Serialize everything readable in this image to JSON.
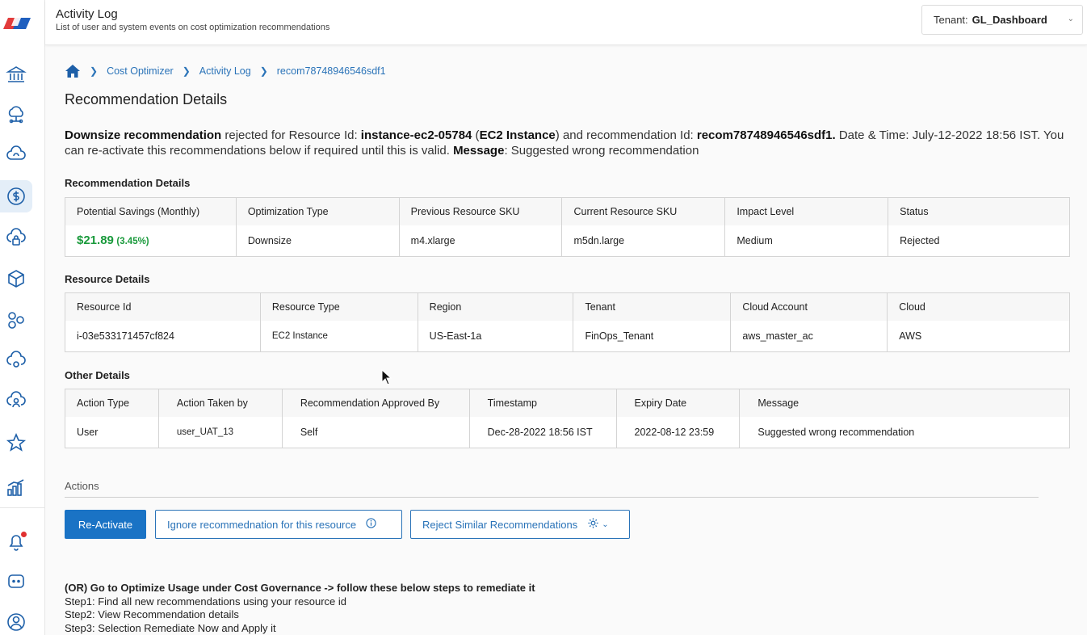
{
  "header": {
    "title": "Activity Log",
    "subtitle": "List of user and system events on cost optimization recommendations",
    "tenant_label": "Tenant:",
    "tenant_value": "GL_Dashboard"
  },
  "sidebar": {
    "items": [
      {
        "icon": "bank-icon"
      },
      {
        "icon": "cloud-network-icon"
      },
      {
        "icon": "cloud-sync-icon"
      },
      {
        "icon": "dollar-icon",
        "active": true
      },
      {
        "icon": "cloud-lock-icon"
      },
      {
        "icon": "cube-icon"
      },
      {
        "icon": "gears-icon"
      },
      {
        "icon": "cloud-gear-icon"
      },
      {
        "icon": "cloud-user-icon"
      },
      {
        "icon": "star-icon"
      },
      {
        "icon": "bar-chart-icon"
      },
      {
        "icon": "bell-icon"
      },
      {
        "icon": "chat-icon"
      },
      {
        "icon": "user-circle-icon"
      }
    ]
  },
  "breadcrumb": {
    "items": [
      "Cost Optimizer",
      "Activity Log",
      "recom78748946546sdf1"
    ]
  },
  "page_title": "Recommendation Details",
  "summary": {
    "rec_type": "Downsize recommendation",
    "t1": " rejected for Resource Id: ",
    "resource_id": "instance-ec2-05784",
    "t2": " (",
    "resource_type": "EC2 Instance",
    "t3": ") and recommendation Id: ",
    "rec_id": "recom78748946546sdf1.",
    "t4": " Date & Time: July-12-2022 18:56 IST. You can re-activate this recommendations below if required until this is valid. ",
    "message_label": "Message",
    "message": ": Suggested wrong recommendation"
  },
  "recommendation_details": {
    "title": "Recommendation Details",
    "headers": [
      "Potential Savings (Monthly)",
      "Optimization Type",
      "Previous Resource SKU",
      "Current Resource SKU",
      "Impact Level",
      "Status"
    ],
    "savings": "$21.89",
    "savings_pct": "(3.45%)",
    "optimization_type": "Downsize",
    "previous_sku": "m4.xlarge",
    "current_sku": "m5dn.large",
    "impact": "Medium",
    "status": "Rejected",
    "impact_color": "#e08a1e",
    "status_color": "#d9442c"
  },
  "resource_details": {
    "title": "Resource Details",
    "headers": [
      "Resource Id",
      "Resource Type",
      "Region",
      "Tenant",
      "Cloud Account",
      "Cloud"
    ],
    "values": [
      "i-03e533171457cf824",
      "EC2 Instance",
      "US-East-1a",
      "FinOps_Tenant",
      "aws_master_ac",
      "AWS"
    ]
  },
  "other_details": {
    "title": "Other Details",
    "headers": [
      "Action Type",
      "Action Taken by",
      "Recommendation Approved By",
      "Timestamp",
      "Expiry Date",
      "Message"
    ],
    "values": [
      "User",
      "user_UAT_13",
      "Self",
      "Dec-28-2022 18:56 IST",
      "2022-08-12 23:59",
      "Suggested wrong recommendation"
    ]
  },
  "actions": {
    "title": "Actions",
    "reactivate": "Re-Activate",
    "ignore": "Ignore recommednation for this resource",
    "reject_similar": "Reject Similar Recommendations"
  },
  "steps": {
    "heading": "(OR) Go to Optimize Usage under Cost Governance -> follow these below steps to remediate it",
    "step1": "Step1: Find all new recommendations using your resource id",
    "step2": "Step2: View Recommendation details",
    "step3": "Step3: Selection Remediate Now and Apply it"
  },
  "colors": {
    "accent": "#1a73c5",
    "link": "#2a73b8",
    "savings": "#1a9a3c"
  }
}
